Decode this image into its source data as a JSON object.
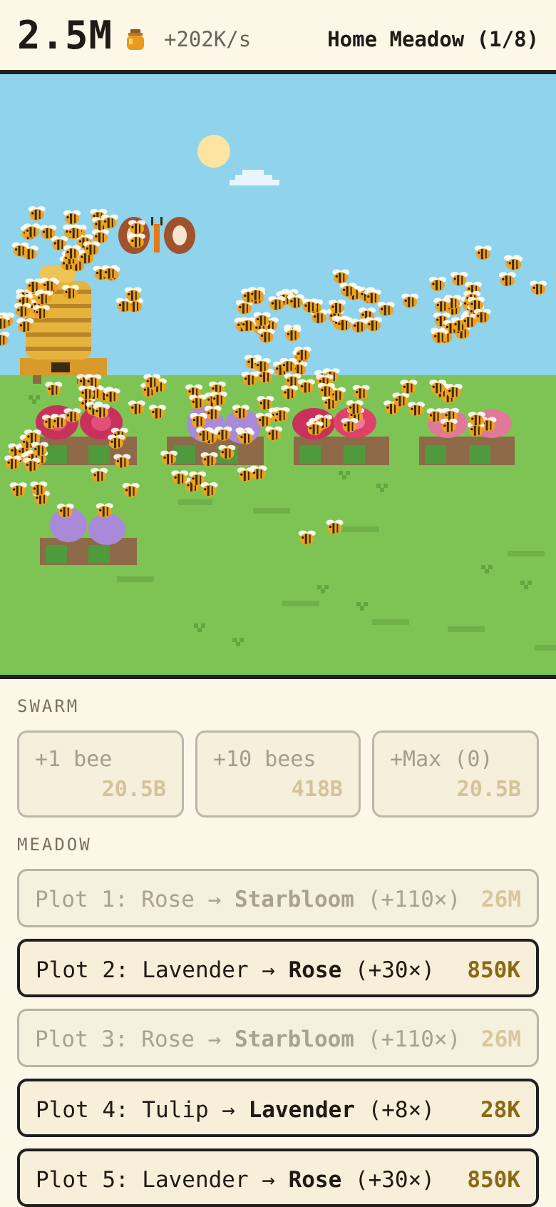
{
  "header": {
    "honey_total": "2.5M",
    "honey_icon": "honey-jar-icon",
    "rate": "+202K/s",
    "location": "Home Meadow (1/8)"
  },
  "scene": {
    "flowers": [
      "Rose",
      "Lavender",
      "Rose",
      "Tulip",
      "Lavender"
    ],
    "colors": {
      "sky": "#8fd3ec",
      "grass": "#7ec454",
      "sun": "#fbe5a0",
      "hive": "#e6b43c",
      "bee_body": "#f0a21c"
    }
  },
  "swarm": {
    "label": "SWARM",
    "buttons": [
      {
        "label": "+1 bee",
        "cost": "20.5B"
      },
      {
        "label": "+10 bees",
        "cost": "418B"
      },
      {
        "label": "+Max (0)",
        "cost": "20.5B"
      }
    ]
  },
  "meadow": {
    "label": "MEADOW",
    "plots": [
      {
        "prefix": "Plot 1: Rose → ",
        "target": "Starbloom",
        "mult": " (+110×)",
        "cost": "26M",
        "affordable": false
      },
      {
        "prefix": "Plot 2: Lavender → ",
        "target": "Rose",
        "mult": " (+30×)",
        "cost": "850K",
        "affordable": true
      },
      {
        "prefix": "Plot 3: Rose → ",
        "target": "Starbloom",
        "mult": " (+110×)",
        "cost": "26M",
        "affordable": false
      },
      {
        "prefix": "Plot 4: Tulip → ",
        "target": "Lavender",
        "mult": " (+8×)",
        "cost": "28K",
        "affordable": true
      },
      {
        "prefix": "Plot 5: Lavender → ",
        "target": "Rose",
        "mult": " (+30×)",
        "cost": "850K",
        "affordable": true
      }
    ]
  }
}
